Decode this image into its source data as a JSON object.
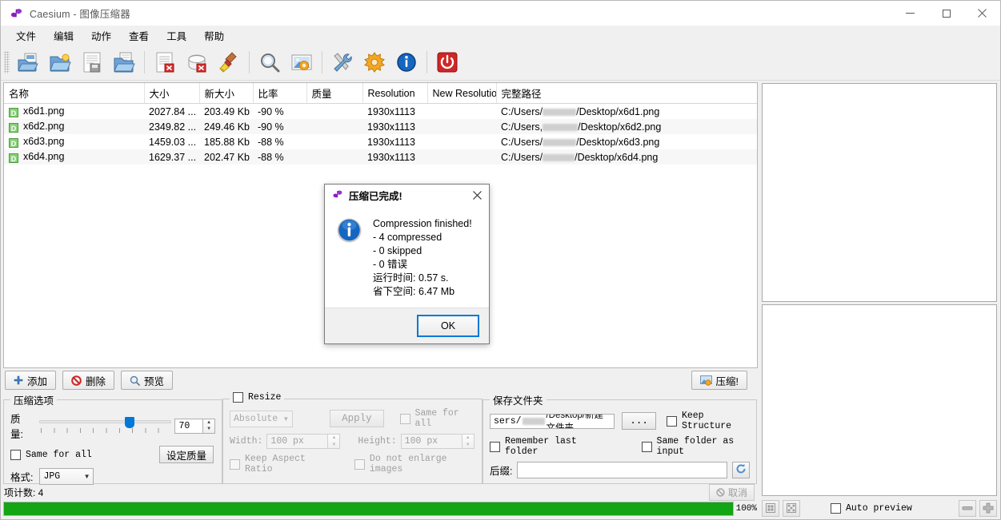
{
  "window": {
    "title": "Caesium - 图像压缩器",
    "icon": "caesium-butterfly-icon",
    "minimize": "–",
    "maximize": "□",
    "close": "✕"
  },
  "menu": {
    "items": [
      {
        "label": "文件",
        "name": "menu-file"
      },
      {
        "label": "编辑",
        "name": "menu-edit"
      },
      {
        "label": "动作",
        "name": "menu-actions"
      },
      {
        "label": "查看",
        "name": "menu-view"
      },
      {
        "label": "工具",
        "name": "menu-tools"
      },
      {
        "label": "帮助",
        "name": "menu-help"
      }
    ]
  },
  "toolbar": {
    "buttons": [
      {
        "name": "add-files-icon",
        "tip": "添加文件"
      },
      {
        "name": "add-folder-icon",
        "tip": "添加文件夹"
      },
      {
        "name": "save-list-icon",
        "tip": "保存列表"
      },
      {
        "name": "open-list-icon",
        "tip": "打开列表"
      },
      {
        "name": "remove-item-icon",
        "tip": "移除"
      },
      {
        "name": "clear-list-icon",
        "tip": "清空列表"
      },
      {
        "name": "clean-icon",
        "tip": "清理"
      },
      {
        "name": "preview-zoom-icon",
        "tip": "预览"
      },
      {
        "name": "compress-image-icon",
        "tip": "压缩"
      },
      {
        "name": "tools-icon",
        "tip": "工具"
      },
      {
        "name": "preferences-icon",
        "tip": "首选项"
      },
      {
        "name": "info-icon",
        "tip": "关于"
      },
      {
        "name": "exit-icon",
        "tip": "退出"
      }
    ]
  },
  "table": {
    "columns": [
      "名称",
      "大小",
      "新大小",
      "比率",
      "质量",
      "Resolution",
      "New Resolution",
      "完整路径"
    ],
    "rows": [
      {
        "name": "x6d1.png",
        "size": "2027.84 ...",
        "new_size": "203.49 Kb",
        "ratio": "-90 %",
        "quality": "",
        "resolution": "1930x1113",
        "new_resolution": "",
        "path_prefix": "C:/Users/",
        "path_suffix": "/Desktop/x6d1.png"
      },
      {
        "name": "x6d2.png",
        "size": "2349.82 ...",
        "new_size": "249.46 Kb",
        "ratio": "-90 %",
        "quality": "",
        "resolution": "1930x1113",
        "new_resolution": "",
        "path_prefix": "C:/Users,",
        "path_suffix": "/Desktop/x6d2.png"
      },
      {
        "name": "x6d3.png",
        "size": "1459.03 ...",
        "new_size": "185.88 Kb",
        "ratio": "-88 %",
        "quality": "",
        "resolution": "1930x1113",
        "new_resolution": "",
        "path_prefix": "C:/Users/",
        "path_suffix": "/Desktop/x6d3.png"
      },
      {
        "name": "x6d4.png",
        "size": "1629.37 ...",
        "new_size": "202.47 Kb",
        "ratio": "-88 %",
        "quality": "",
        "resolution": "1930x1113",
        "new_resolution": "",
        "path_prefix": "C:/Users/",
        "path_suffix": "/Desktop/x6d4.png"
      }
    ]
  },
  "actions": {
    "add": "添加",
    "remove": "删除",
    "preview": "预览",
    "compress": "压缩!"
  },
  "compress_options": {
    "legend": "压缩选项",
    "quality_label": "质量:",
    "quality_value": "70",
    "quality_percent": 70,
    "same_for_all_label": "Same for all",
    "set_quality_button": "设定质量",
    "format_label": "格式:",
    "format_value": "JPG"
  },
  "resize": {
    "legend": "Resize",
    "mode_value": "Absolute",
    "apply_button": "Apply",
    "same_for_all_label": "Same for all",
    "width_label": "Width:",
    "width_value": "100 px",
    "height_label": "Height:",
    "height_value": "100 px",
    "keep_aspect_label": "Keep Aspect Ratio",
    "do_not_enlarge_label": "Do not enlarge images"
  },
  "save_folder": {
    "legend": "保存文件夹",
    "path_prefix": "sers/",
    "path_suffix": "/Desktop/新建文件夹",
    "browse_button": "...",
    "keep_structure_label": "Keep Structure",
    "remember_last_label": "Remember last folder",
    "same_as_input_label": "Same folder as input",
    "suffix_label": "后缀:",
    "suffix_value": "",
    "reset_icon": "reset-arrow-icon"
  },
  "status": {
    "item_count": "项计数: 4",
    "cancel_button": "取消",
    "progress_percent": "100%",
    "progress_value": 100,
    "progress_color": "#13a513"
  },
  "preview_panel": {
    "fit_icon": "fit-to-window-icon",
    "expand_icon": "actual-size-icon",
    "auto_preview_label": "Auto preview",
    "zoom_out_icon": "zoom-out-icon",
    "zoom_in_icon": "zoom-in-icon"
  },
  "dialog": {
    "title": "压缩已完成!",
    "icon": "caesium-butterfly-icon",
    "close": "✕",
    "lines": [
      "Compression finished!",
      "- 4 compressed",
      "- 0 skipped",
      "- 0 错误",
      "运行时间: 0.57 s.",
      "省下空间: 6.47 Mb"
    ],
    "ok_button": "OK"
  }
}
